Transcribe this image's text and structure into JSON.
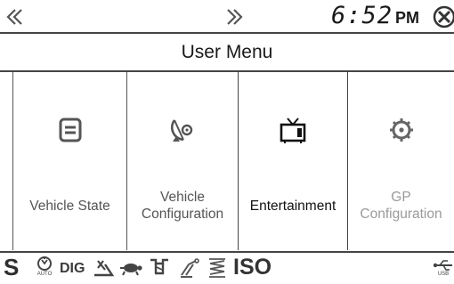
{
  "header": {
    "clock_time": "6:52",
    "clock_ampm": "PM",
    "icons": [
      "chevron-left-icon",
      "chevron-right-icon",
      "close-icon"
    ]
  },
  "title": "User Menu",
  "menu": {
    "items": [
      {
        "line1": "Vehicle State",
        "line2": "",
        "icon": "document-icon",
        "state": "normal"
      },
      {
        "line1": "Vehicle",
        "line2": "Configuration",
        "icon": "satellite-dish-icon",
        "state": "normal"
      },
      {
        "line1": "Entertainment",
        "line2": "",
        "icon": "tv-icon",
        "state": "active"
      },
      {
        "line1": "GP",
        "line2": "Configuration",
        "icon": "gear-icon",
        "state": "disabled"
      }
    ]
  },
  "indicators": {
    "s": "S",
    "auto": "AUTO",
    "dig": "DIG",
    "iso": "ISO",
    "usb": "USB",
    "icons": [
      "auto-mode-icon",
      "diff-lock-icon",
      "turtle-icon",
      "pto-icon",
      "hitch-icon",
      "spring-icon",
      "usb-icon"
    ]
  },
  "colors": {
    "border": "#444444",
    "text": "#222222",
    "disabled_text": "#9a9a9a",
    "icon": "#555555"
  }
}
